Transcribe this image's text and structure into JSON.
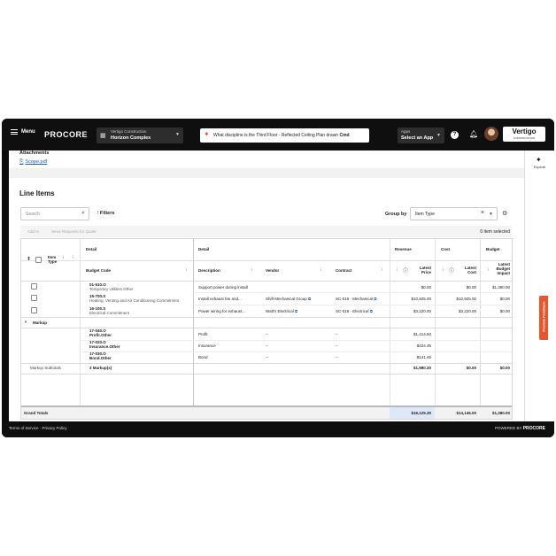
{
  "topbar": {
    "menu_label": "Menu",
    "logo_text": "PROCORE",
    "project": {
      "company": "Vertigo Construction",
      "name": "Horizon Complex"
    },
    "assistant_text": "What discipline is the Third Floor - Reflected Ceiling Plan drawn",
    "assistant_shortcut": "Cmd",
    "apps": {
      "label": "Apps",
      "value": "Select an App"
    },
    "brand": {
      "name": "Vertigo",
      "sub": "CONSTRUCTION"
    }
  },
  "rightrail": {
    "explore_label": "Explore",
    "feedback_label": "Provide Feedback"
  },
  "attachments": {
    "title": "Attachments",
    "file": "Scope.pdf"
  },
  "line_items": {
    "title": "Line Items",
    "search_placeholder": "Search",
    "filters_label": "Filters",
    "group_by_label": "Group by",
    "group_by_value": "Item Type",
    "bulk_add": "Add to",
    "bulk_send": "Send Requests for Quote",
    "selected_count": "0 item selected",
    "groups": {
      "detail_left": "Detail",
      "detail": "Detail",
      "revenue": "Revenue",
      "cost": "Cost",
      "budget": "Budget"
    },
    "columns": {
      "item_type": "Item\nType",
      "budget_code": "Budget Code",
      "description": "Description",
      "vendor": "Vendor",
      "contract": "Contract",
      "latest_price": "Latest\nPrice",
      "latest_cost": "Latest\nCost",
      "latest_budget_impact": "Latest\nBudget\nImpact"
    },
    "rows": [
      {
        "code": "01-510.O",
        "code_desc": "Temporary Utilities.Other",
        "description": "Support power during install",
        "vendor": "",
        "contract": "",
        "price": "$0.00",
        "cost": "$0.00",
        "budget": "$1,380.00"
      },
      {
        "code": "15-700.S",
        "code_desc": "Heating, Venting and Air Conditioning.Commitment",
        "description": "Install exhaust fan and...",
        "vendor": "Shift Mechanical Group",
        "contract": "SC-015 - Mechanical",
        "price": "$10,925.00",
        "cost": "$10,925.00",
        "budget": "$0.00"
      },
      {
        "code": "16-100.S",
        "code_desc": "Electrical.Commitment",
        "description": "Power wiring for exhaust...",
        "vendor": "Watt's Electrical",
        "contract": "SC-016 - Electrical",
        "price": "$3,220.00",
        "cost": "$3,220.00",
        "budget": "$0.00"
      }
    ],
    "markup_group_label": "Markup",
    "markup_rows": [
      {
        "code": "17-040.O",
        "code_desc": "Profit.Other",
        "description": "Profit",
        "vendor": "--",
        "contract": "--",
        "price": "$1,414.50"
      },
      {
        "code": "17-020.O",
        "code_desc": "Insurance.Other",
        "description": "Insurance",
        "vendor": "--",
        "contract": "--",
        "price": "$424.35"
      },
      {
        "code": "17-030.O",
        "code_desc": "Bond.Other",
        "description": "Bond",
        "vendor": "--",
        "contract": "--",
        "price": "$141.45"
      }
    ],
    "markup_subtotal": {
      "label": "Markup Subtotals",
      "count": "3 Markup(s)",
      "price": "$1,980.30",
      "cost": "$0.00",
      "budget": "$0.00"
    },
    "grand_totals": {
      "label": "Grand Totals",
      "price": "$16,125.30",
      "cost": "$14,145.00",
      "budget": "$1,380.00"
    }
  },
  "footer": {
    "links": "Terms of Service · Privacy Policy",
    "powered_by": "POWERED BY",
    "powered_brand": "PROCORE"
  }
}
